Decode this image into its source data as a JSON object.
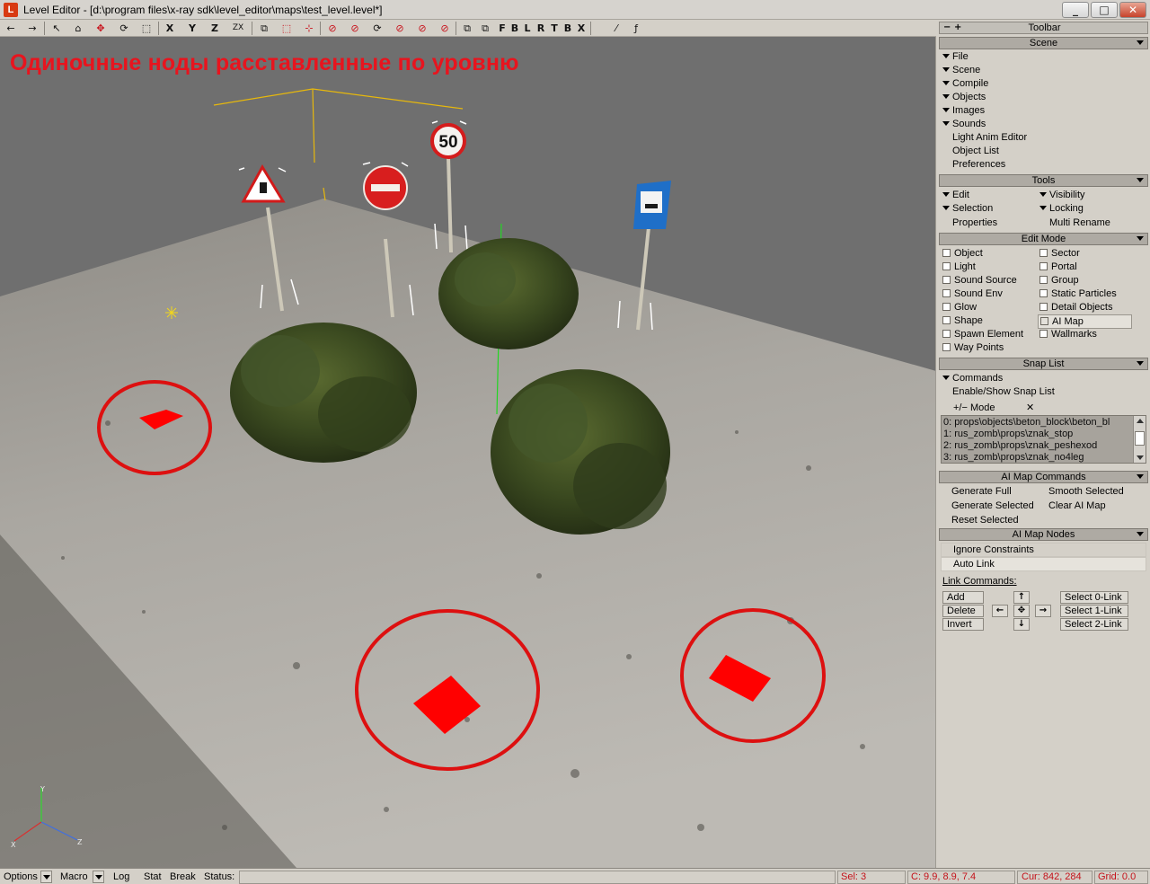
{
  "window": {
    "app_icon": "L",
    "title": "Level Editor - [d:\\program files\\x-ray sdk\\level_editor\\maps\\test_level.level*]",
    "min": "_",
    "max": "□",
    "close": "✕"
  },
  "toolbar": {
    "buttons": [
      "←",
      "→",
      "↖",
      "⌂",
      "✥",
      "⟳",
      "⬚",
      "X",
      "Y",
      "Z",
      "ZX",
      "⧉",
      "⬚",
      "⊹",
      "⊘",
      "⊘",
      "⟳",
      "⊘",
      "⊘",
      "⊘",
      "⧉",
      "⧉",
      "F",
      "B",
      "L",
      "R",
      "T",
      "B",
      "X",
      "⁄",
      "ƒ"
    ]
  },
  "viewport": {
    "caption": "Одиночные ноды расставленные по уровню",
    "axis_y": "Y",
    "axis_x": "X",
    "axis_z": "Z"
  },
  "panel": {
    "top_minus": "−",
    "top_plus": "+",
    "title": "Toolbar",
    "scene": {
      "header": "Scene",
      "items": [
        "File",
        "Scene",
        "Compile",
        "Objects",
        "Images",
        "Sounds"
      ],
      "plain_items": [
        "Light Anim Editor",
        "Object List",
        "Preferences"
      ]
    },
    "tools": {
      "header": "Tools",
      "edit": "Edit",
      "visibility": "Visibility",
      "selection": "Selection",
      "locking": "Locking",
      "properties": "Properties",
      "multi_rename": "Multi Rename"
    },
    "edit_mode": {
      "header": "Edit Mode",
      "left": [
        "Object",
        "Light",
        "Sound Source",
        "Sound Env",
        "Glow",
        "Shape",
        "Spawn Element",
        "Way Points"
      ],
      "right": [
        "Sector",
        "Portal",
        "Group",
        "Static Particles",
        "Detail Objects",
        "AI Map",
        "Wallmarks"
      ]
    },
    "snap_list": {
      "header": "Snap List",
      "commands": "Commands",
      "enable_show": "Enable/Show Snap List",
      "mode_label": "+/− Mode",
      "mode_x": "✕",
      "rows": [
        "0: props\\objects\\beton_block\\beton_bl",
        "1: rus_zomb\\props\\znak_stop",
        "2: rus_zomb\\props\\znak_peshexod",
        "3: rus_zomb\\props\\znak_no4leg"
      ]
    },
    "ai_map_commands": {
      "header": "AI Map Commands",
      "generate_full": "Generate Full",
      "smooth_selected": "Smooth Selected",
      "generate_selected": "Generate Selected",
      "clear_ai_map": "Clear AI Map",
      "reset_selected": "Reset Selected"
    },
    "ai_map_nodes": {
      "header": "AI Map Nodes",
      "ignore_constraints": "Ignore Constraints",
      "auto_link": "Auto Link",
      "link_commands": "Link Commands:",
      "add": "Add",
      "delete": "Delete",
      "invert": "Invert",
      "select_0": "Select 0-Link",
      "select_1": "Select 1-Link",
      "select_2": "Select 2-Link",
      "arrow_up": "↑",
      "arrow_left": "←",
      "arrow_center": "✥",
      "arrow_right": "→",
      "arrow_down": "↓"
    }
  },
  "status": {
    "options": "Options",
    "macro": "Macro",
    "log": "Log",
    "stat": "Stat",
    "break": "Break",
    "status_label": "Status:",
    "sel": "Sel: 3",
    "coord": "C: 9.9, 8.9, 7.4",
    "cur": "Cur: 842, 284",
    "grid": "Grid: 0.0"
  },
  "colors": {
    "caption": "#e8141e",
    "ai_node": "#ff0000",
    "highlight_circle": "#dd1010",
    "bush": "#3d4a22",
    "ground": "#b8b5ae"
  }
}
